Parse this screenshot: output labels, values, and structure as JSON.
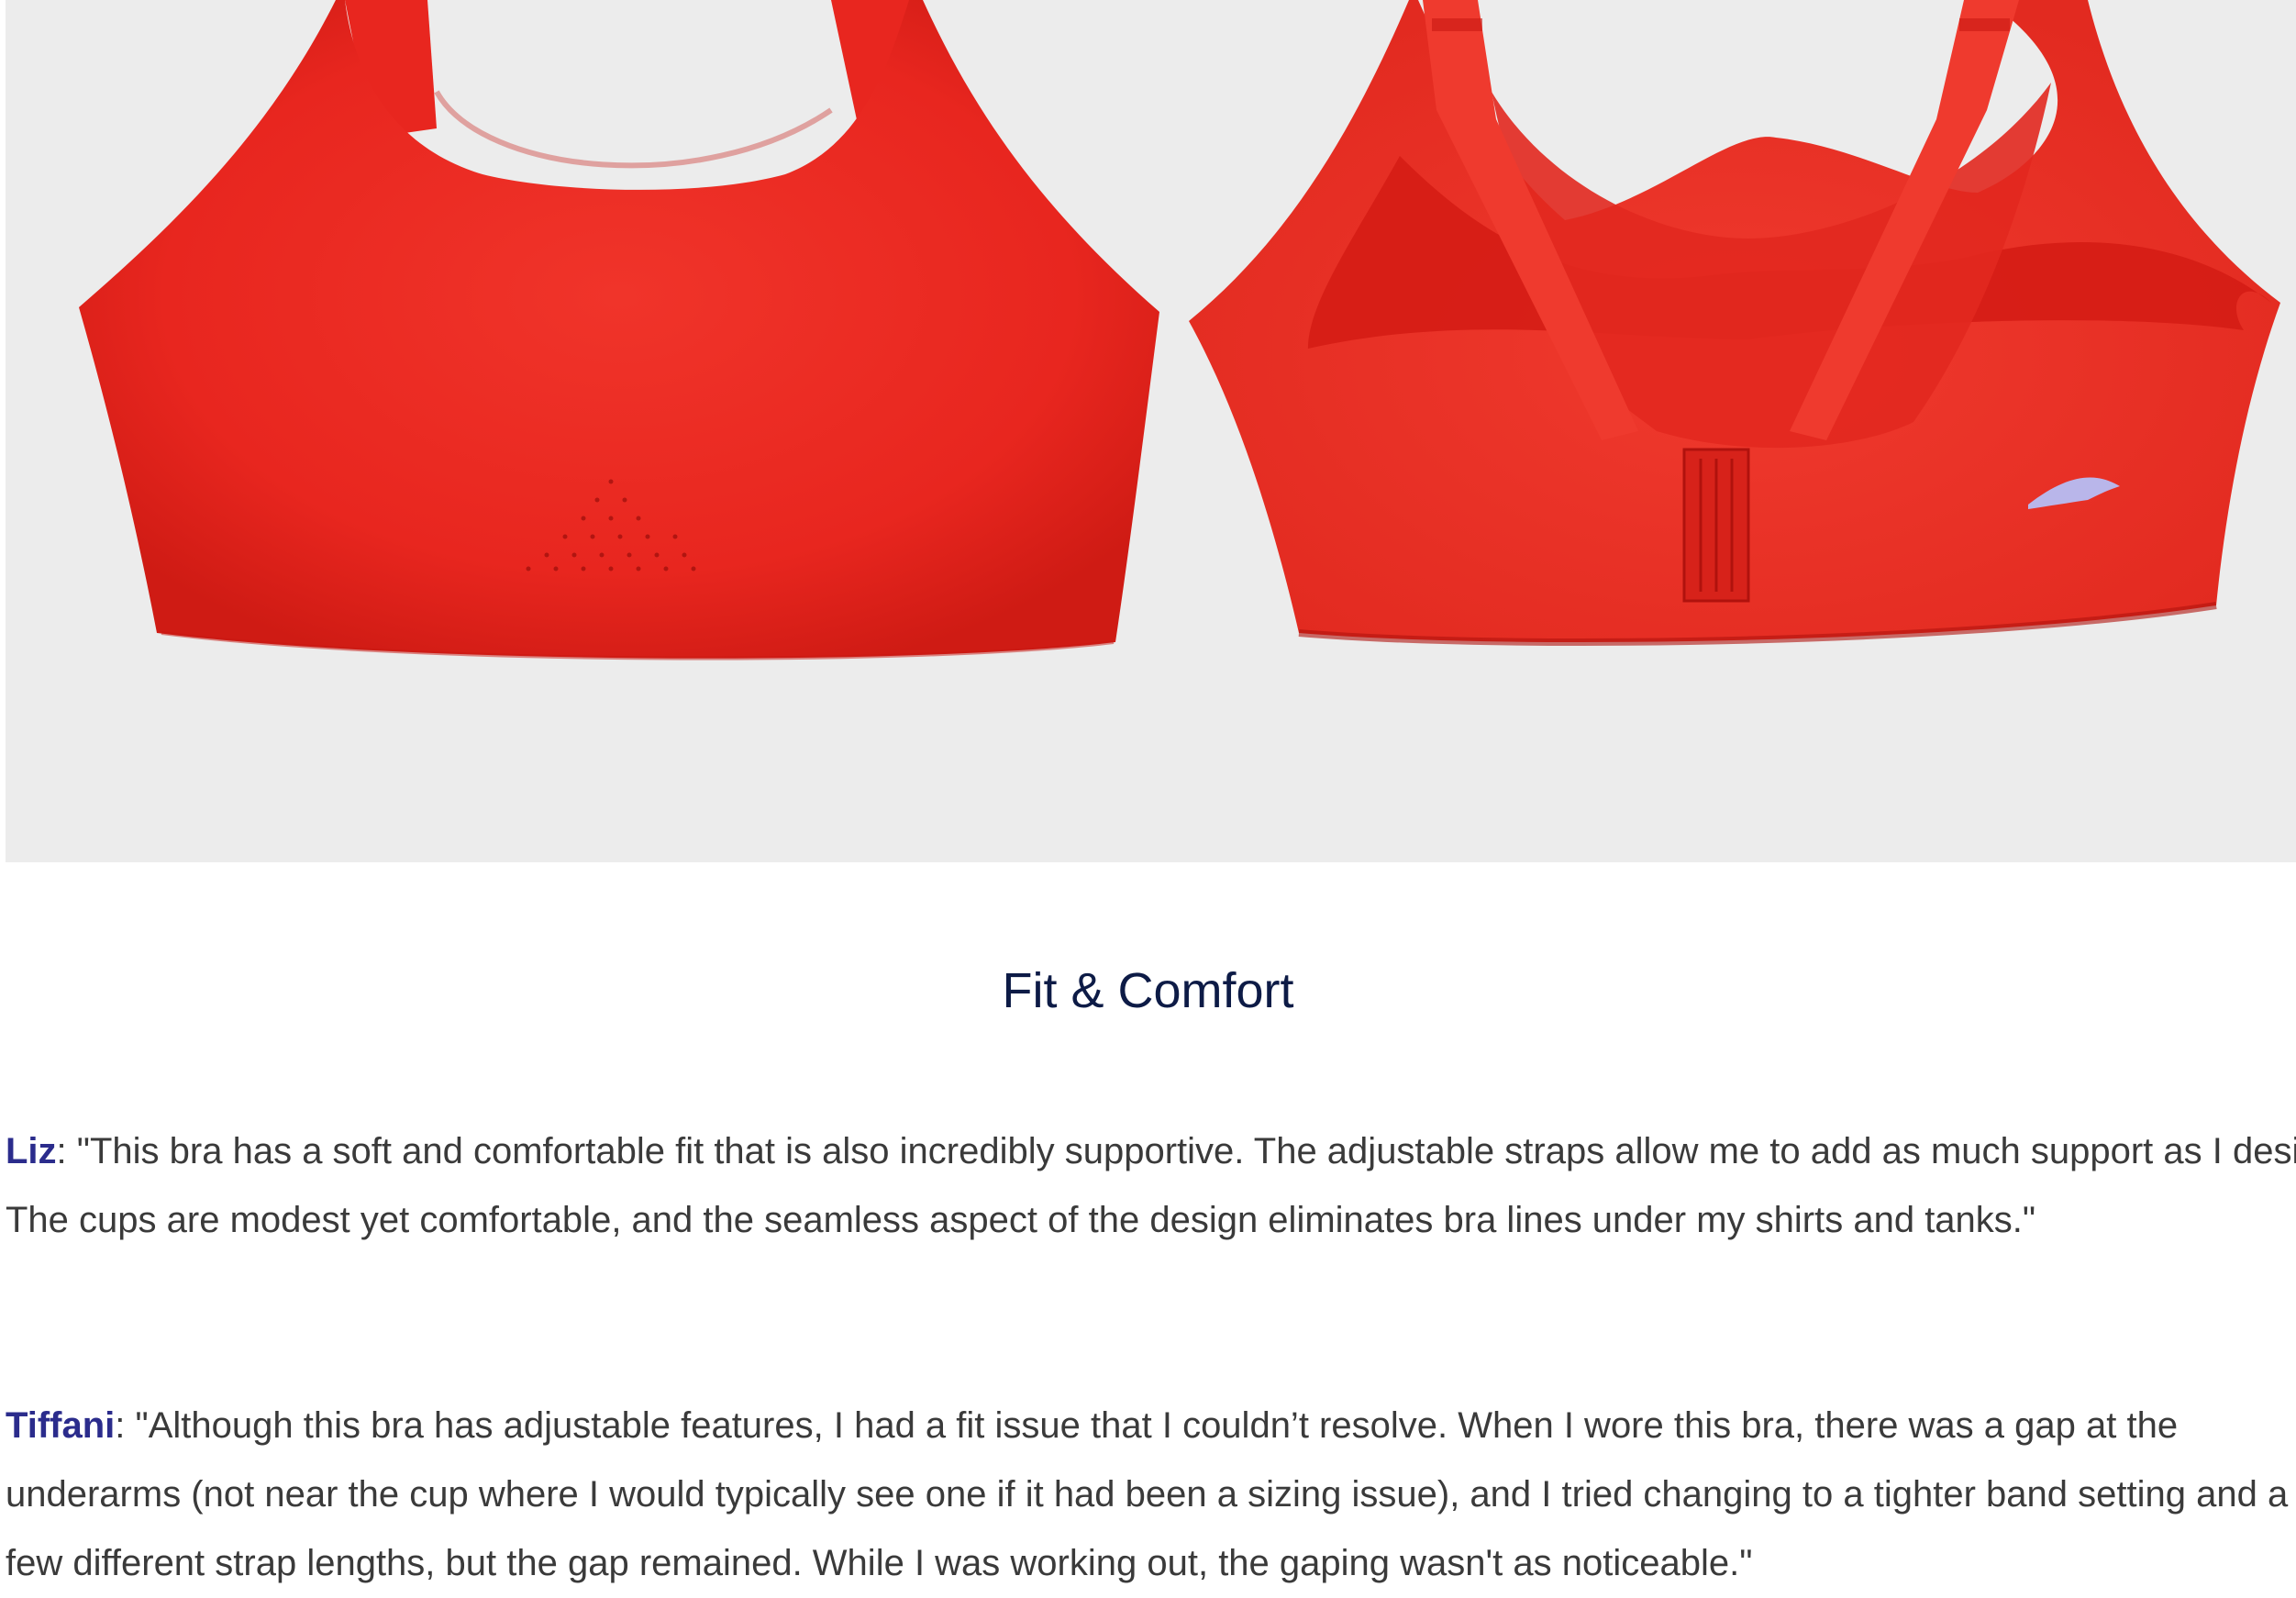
{
  "hero_image": {
    "alt": "Red sports bra, front and back views",
    "colors": {
      "background": "#ececec",
      "fabric": "#e8261f",
      "fabric_shadow": "#c81712",
      "logo": "#b9b6ea"
    }
  },
  "section_title": "Fit & Comfort",
  "reviews": [
    {
      "name": "Liz",
      "separator": ": ",
      "text": "\"This bra has a soft and comfortable fit that is also incredibly supportive. The adjustable straps allow me to add as much support as I desire. The cups are modest yet comfortable, and the seamless aspect of the design eliminates bra lines under my shirts and tanks.\""
    },
    {
      "name": "Tiffani",
      "separator": ": ",
      "text": "\"Although this bra has adjustable features, I had a fit issue that I couldn’t resolve. When I wore this bra, there was a gap at the underarms (not near the cup where I would typically see one if it had been a sizing issue), and I tried changing to a tighter band setting and a few different strap lengths, but the gap remained. While I was working out, the gaping wasn't as noticeable.\""
    }
  ],
  "colors": {
    "title": "#0d1b46",
    "reviewer_name": "#2b2c8c",
    "body_text": "#3a3a3a"
  }
}
